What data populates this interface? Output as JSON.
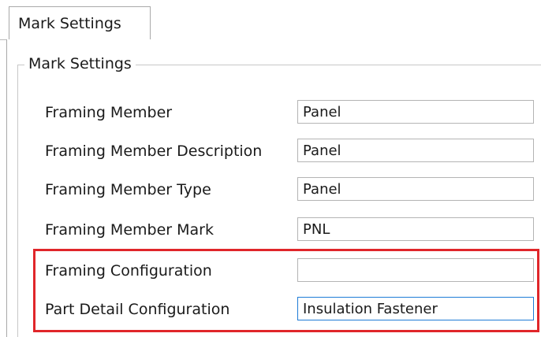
{
  "tabs": [
    {
      "label": "Mark Settings",
      "active": true
    }
  ],
  "group": {
    "title": "Mark Settings"
  },
  "fields": [
    {
      "label": "Framing Member",
      "value": "Panel"
    },
    {
      "label": "Framing Member Description",
      "value": "Panel"
    },
    {
      "label": "Framing Member Type",
      "value": "Panel"
    },
    {
      "label": "Framing Member Mark",
      "value": "PNL"
    },
    {
      "label": "Framing Configuration",
      "value": ""
    },
    {
      "label": "Part Detail Configuration",
      "value": "Insulation Fastener"
    }
  ],
  "colors": {
    "highlight": "#e0262a",
    "focus_border": "#1e7bd6"
  }
}
